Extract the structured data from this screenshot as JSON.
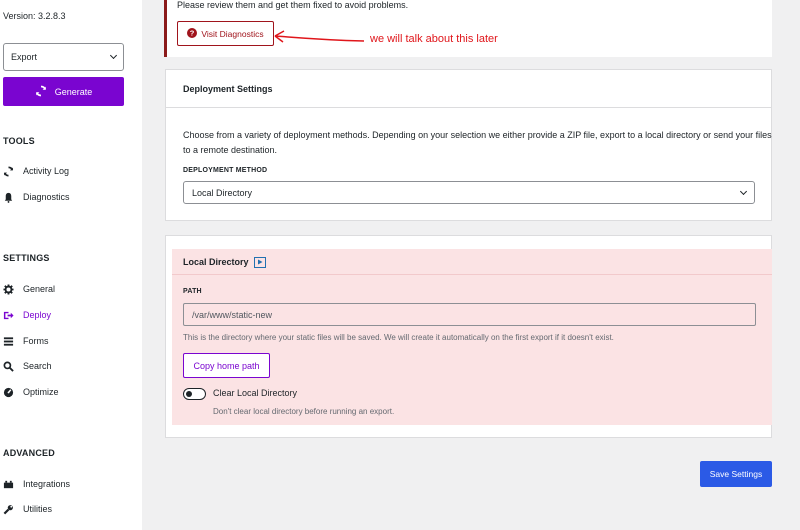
{
  "sidebar": {
    "version": "Version: 3.2.8.3",
    "export_select": "Export",
    "generate_label": "Generate",
    "tools_title": "TOOLS",
    "tools": [
      {
        "label": "Activity Log",
        "icon": "refresh-icon"
      },
      {
        "label": "Diagnostics",
        "icon": "bell-icon"
      }
    ],
    "settings_title": "SETTINGS",
    "settings": [
      {
        "label": "General",
        "icon": "gear-icon"
      },
      {
        "label": "Deploy",
        "icon": "deploy-icon"
      },
      {
        "label": "Forms",
        "icon": "list-icon"
      },
      {
        "label": "Search",
        "icon": "search-icon"
      },
      {
        "label": "Optimize",
        "icon": "gauge-icon"
      }
    ],
    "advanced_title": "ADVANCED",
    "advanced": [
      {
        "label": "Integrations",
        "icon": "plug-icon"
      },
      {
        "label": "Utilities",
        "icon": "wrench-icon"
      }
    ]
  },
  "notice": {
    "text": "Please review them and get them fixed to avoid problems.",
    "button_label": "Visit Diagnostics",
    "annotation": "we will talk about this later"
  },
  "deployment": {
    "title": "Deployment Settings",
    "description": "Choose from a variety of deployment methods. Depending on your selection we either provide a ZIP file, export to a local directory or send your files to a remote destination.",
    "method_label": "DEPLOYMENT METHOD",
    "method_value": "Local Directory"
  },
  "local": {
    "title": "Local Directory",
    "path_label": "PATH",
    "path_value": "/var/www/static-new",
    "path_help": "This is the directory where your static files will be saved. We will create it automatically on the first export if it doesn't exist.",
    "copy_button": "Copy home path",
    "toggle_label": "Clear Local Directory",
    "toggle_help": "Don't clear local directory before running an export."
  },
  "save_button": "Save Settings",
  "colors": {
    "accent": "#7a05d0",
    "danger": "#a0141c",
    "annotation": "#e0161b",
    "primary": "#2b5ae6",
    "highlight": "#fbe3e4"
  }
}
